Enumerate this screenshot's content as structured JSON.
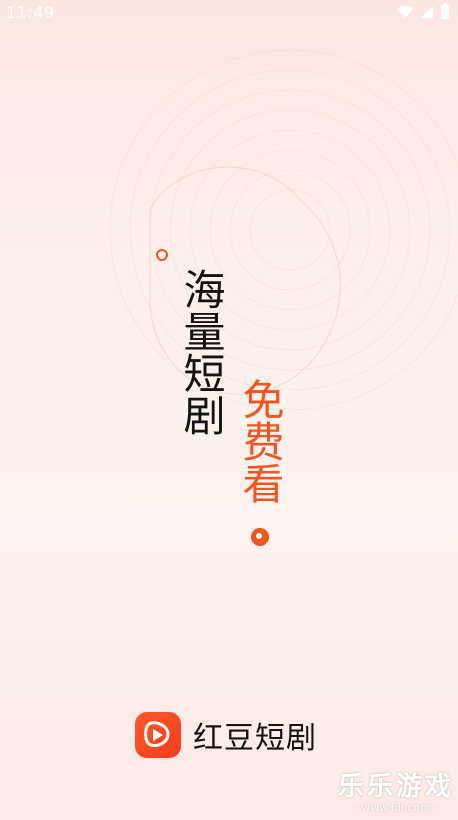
{
  "status_bar": {
    "time": "11:49",
    "icons": [
      "wifi-icon",
      "signal-icon",
      "battery-icon"
    ]
  },
  "slogan": {
    "line1": "海量短剧",
    "line2": "免费看"
  },
  "brand": {
    "name": "红豆短剧",
    "logo_icon": "play-bean-logo-icon"
  },
  "watermark": {
    "text": "乐乐游戏",
    "url": "- www.6ll.com -"
  },
  "colors": {
    "accent": "#f0561f",
    "text": "#141414",
    "background": "#fdf0ec"
  }
}
